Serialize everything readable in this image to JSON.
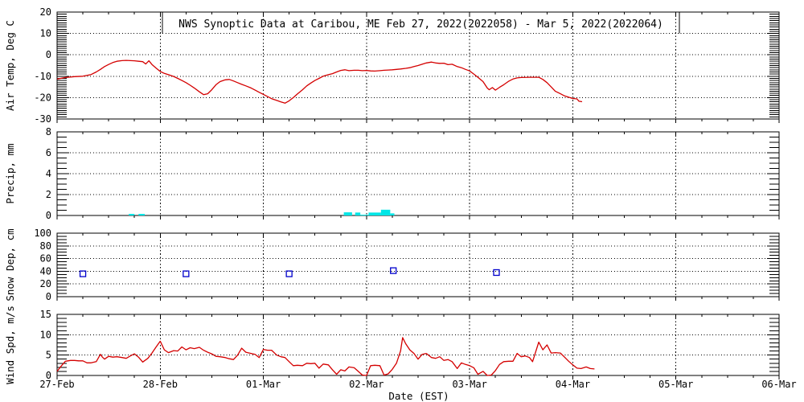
{
  "title": "NWS Synoptic Data at Caribou, ME  Feb 27, 2022(2022058) - Mar  5, 2022(2022064)",
  "xlabel": "Date (EST)",
  "colors": {
    "line_red": "#d40000",
    "precip_cyan": "#00e6e6",
    "snow_blue": "#0000cc",
    "frame_black": "#000000",
    "background": "#ffffff"
  },
  "x_axis": {
    "tick_labels": [
      "27-Feb",
      "28-Feb",
      "01-Mar",
      "02-Mar",
      "03-Mar",
      "04-Mar",
      "05-Mar",
      "06-Mar"
    ],
    "range_days": [
      0,
      7
    ],
    "minor_tick_hours": 6
  },
  "chart_data": [
    {
      "type": "line",
      "name": "air-temperature",
      "ylabel": "Air Temp, Deg C",
      "ylim": [
        -30,
        20
      ],
      "yticks": [
        -30,
        -20,
        -10,
        0,
        10,
        20
      ],
      "ygrid": [
        -20,
        -10,
        0,
        10
      ],
      "yminor": 1,
      "color_key": "line_red",
      "points": [
        [
          0.0,
          -11.3
        ],
        [
          0.08,
          -10.6
        ],
        [
          0.17,
          -10.2
        ],
        [
          0.25,
          -10.0
        ],
        [
          0.33,
          -9.2
        ],
        [
          0.38,
          -8.0
        ],
        [
          0.42,
          -6.8
        ],
        [
          0.46,
          -5.5
        ],
        [
          0.5,
          -4.5
        ],
        [
          0.54,
          -3.6
        ],
        [
          0.58,
          -3.0
        ],
        [
          0.63,
          -2.7
        ],
        [
          0.67,
          -2.6
        ],
        [
          0.71,
          -2.7
        ],
        [
          0.75,
          -2.8
        ],
        [
          0.79,
          -3.0
        ],
        [
          0.83,
          -3.2
        ],
        [
          0.86,
          -4.3
        ],
        [
          0.89,
          -2.8
        ],
        [
          0.92,
          -4.5
        ],
        [
          0.96,
          -6.2
        ],
        [
          1.0,
          -7.8
        ],
        [
          1.04,
          -8.7
        ],
        [
          1.08,
          -9.3
        ],
        [
          1.13,
          -10.1
        ],
        [
          1.17,
          -11.0
        ],
        [
          1.21,
          -12.0
        ],
        [
          1.25,
          -13.0
        ],
        [
          1.29,
          -14.2
        ],
        [
          1.33,
          -15.5
        ],
        [
          1.38,
          -17.3
        ],
        [
          1.42,
          -18.6
        ],
        [
          1.46,
          -18.2
        ],
        [
          1.5,
          -16.3
        ],
        [
          1.54,
          -14.0
        ],
        [
          1.58,
          -12.5
        ],
        [
          1.63,
          -11.7
        ],
        [
          1.67,
          -11.5
        ],
        [
          1.71,
          -12.2
        ],
        [
          1.75,
          -13.0
        ],
        [
          1.79,
          -13.8
        ],
        [
          1.83,
          -14.5
        ],
        [
          1.88,
          -15.5
        ],
        [
          1.92,
          -16.5
        ],
        [
          1.96,
          -17.5
        ],
        [
          2.0,
          -18.5
        ],
        [
          2.04,
          -19.5
        ],
        [
          2.08,
          -20.5
        ],
        [
          2.13,
          -21.3
        ],
        [
          2.17,
          -22.0
        ],
        [
          2.21,
          -22.6
        ],
        [
          2.25,
          -21.5
        ],
        [
          2.29,
          -20.0
        ],
        [
          2.33,
          -18.3
        ],
        [
          2.38,
          -16.3
        ],
        [
          2.42,
          -14.5
        ],
        [
          2.46,
          -13.2
        ],
        [
          2.5,
          -12.0
        ],
        [
          2.54,
          -11.0
        ],
        [
          2.58,
          -10.0
        ],
        [
          2.63,
          -9.3
        ],
        [
          2.67,
          -8.8
        ],
        [
          2.71,
          -8.0
        ],
        [
          2.75,
          -7.3
        ],
        [
          2.79,
          -7.0
        ],
        [
          2.83,
          -7.4
        ],
        [
          2.88,
          -7.2
        ],
        [
          2.92,
          -7.2
        ],
        [
          2.96,
          -7.4
        ],
        [
          3.0,
          -7.3
        ],
        [
          3.04,
          -7.5
        ],
        [
          3.08,
          -7.6
        ],
        [
          3.13,
          -7.4
        ],
        [
          3.17,
          -7.2
        ],
        [
          3.21,
          -7.1
        ],
        [
          3.25,
          -7.0
        ],
        [
          3.29,
          -6.8
        ],
        [
          3.33,
          -6.6
        ],
        [
          3.38,
          -6.3
        ],
        [
          3.42,
          -6.0
        ],
        [
          3.46,
          -5.5
        ],
        [
          3.5,
          -5.0
        ],
        [
          3.54,
          -4.4
        ],
        [
          3.58,
          -3.8
        ],
        [
          3.63,
          -3.4
        ],
        [
          3.67,
          -3.8
        ],
        [
          3.71,
          -4.0
        ],
        [
          3.75,
          -3.9
        ],
        [
          3.79,
          -4.6
        ],
        [
          3.83,
          -4.4
        ],
        [
          3.88,
          -5.5
        ],
        [
          3.92,
          -6.0
        ],
        [
          3.96,
          -6.8
        ],
        [
          4.0,
          -7.5
        ],
        [
          4.04,
          -9.0
        ],
        [
          4.08,
          -10.5
        ],
        [
          4.13,
          -12.5
        ],
        [
          4.17,
          -15.5
        ],
        [
          4.19,
          -16.3
        ],
        [
          4.22,
          -15.3
        ],
        [
          4.25,
          -16.5
        ],
        [
          4.29,
          -15.2
        ],
        [
          4.33,
          -14.0
        ],
        [
          4.38,
          -12.3
        ],
        [
          4.42,
          -11.3
        ],
        [
          4.46,
          -10.8
        ],
        [
          4.5,
          -10.6
        ],
        [
          4.58,
          -10.5
        ],
        [
          4.67,
          -10.5
        ],
        [
          4.71,
          -11.5
        ],
        [
          4.75,
          -13.0
        ],
        [
          4.79,
          -15.0
        ],
        [
          4.83,
          -17.0
        ],
        [
          4.88,
          -18.2
        ],
        [
          4.92,
          -19.2
        ],
        [
          4.96,
          -19.8
        ],
        [
          5.0,
          -20.4
        ],
        [
          5.04,
          -20.6
        ],
        [
          5.06,
          -21.7
        ],
        [
          5.09,
          -21.9
        ]
      ]
    },
    {
      "type": "bar",
      "name": "precipitation",
      "ylabel": "Precip, mm",
      "ylim": [
        0,
        8
      ],
      "yticks": [
        0,
        2,
        4,
        6,
        8
      ],
      "ygrid": [
        2,
        4,
        6
      ],
      "yminor": 0.5,
      "color_key": "precip_cyan",
      "bars": [
        [
          0.695,
          0.75,
          0.15
        ],
        [
          0.79,
          0.85,
          0.15
        ],
        [
          2.78,
          2.86,
          0.3
        ],
        [
          2.89,
          2.94,
          0.28
        ],
        [
          2.94,
          3.02,
          0.07
        ],
        [
          3.02,
          3.14,
          0.28
        ],
        [
          3.14,
          3.23,
          0.55
        ],
        [
          3.23,
          3.27,
          0.2
        ]
      ]
    },
    {
      "type": "scatter",
      "name": "snow-depth",
      "ylabel": "Snow Dep, cm",
      "ylim": [
        0,
        100
      ],
      "yticks": [
        0,
        20,
        40,
        60,
        80,
        100
      ],
      "ygrid": [
        20,
        40,
        60,
        80
      ],
      "yminor": 5,
      "color_key": "snow_blue",
      "marker": "open-square",
      "points": [
        [
          0.25,
          36
        ],
        [
          1.25,
          36
        ],
        [
          2.25,
          36
        ],
        [
          3.26,
          41
        ],
        [
          4.26,
          38
        ]
      ]
    },
    {
      "type": "line",
      "name": "wind-speed",
      "ylabel": "Wind Spd, m/s",
      "ylim": [
        0,
        15
      ],
      "yticks": [
        0,
        5,
        10,
        15
      ],
      "ygrid": [
        5,
        10
      ],
      "yminor": 1,
      "color_key": "line_red",
      "points": [
        [
          0.0,
          1.0
        ],
        [
          0.04,
          2.3
        ],
        [
          0.08,
          3.5
        ],
        [
          0.13,
          3.7
        ],
        [
          0.17,
          3.7
        ],
        [
          0.21,
          3.6
        ],
        [
          0.25,
          3.6
        ],
        [
          0.29,
          3.1
        ],
        [
          0.33,
          3.1
        ],
        [
          0.38,
          3.4
        ],
        [
          0.42,
          5.2
        ],
        [
          0.44,
          4.5
        ],
        [
          0.46,
          4.0
        ],
        [
          0.5,
          4.7
        ],
        [
          0.54,
          4.5
        ],
        [
          0.58,
          4.6
        ],
        [
          0.63,
          4.4
        ],
        [
          0.67,
          4.2
        ],
        [
          0.71,
          4.8
        ],
        [
          0.75,
          5.3
        ],
        [
          0.79,
          4.5
        ],
        [
          0.83,
          3.3
        ],
        [
          0.88,
          4.2
        ],
        [
          0.92,
          5.5
        ],
        [
          0.96,
          7.0
        ],
        [
          1.0,
          8.4
        ],
        [
          1.04,
          6.3
        ],
        [
          1.08,
          5.6
        ],
        [
          1.13,
          6.1
        ],
        [
          1.17,
          6.0
        ],
        [
          1.21,
          7.0
        ],
        [
          1.25,
          6.3
        ],
        [
          1.29,
          6.8
        ],
        [
          1.33,
          6.6
        ],
        [
          1.38,
          6.9
        ],
        [
          1.42,
          6.2
        ],
        [
          1.46,
          5.7
        ],
        [
          1.5,
          5.3
        ],
        [
          1.54,
          4.7
        ],
        [
          1.58,
          4.6
        ],
        [
          1.63,
          4.4
        ],
        [
          1.67,
          4.1
        ],
        [
          1.71,
          3.9
        ],
        [
          1.75,
          5.0
        ],
        [
          1.79,
          6.7
        ],
        [
          1.83,
          5.7
        ],
        [
          1.88,
          5.4
        ],
        [
          1.92,
          5.2
        ],
        [
          1.96,
          4.4
        ],
        [
          2.0,
          6.4
        ],
        [
          2.04,
          6.2
        ],
        [
          2.08,
          6.2
        ],
        [
          2.13,
          5.0
        ],
        [
          2.17,
          4.6
        ],
        [
          2.21,
          4.4
        ],
        [
          2.25,
          3.4
        ],
        [
          2.29,
          2.4
        ],
        [
          2.33,
          2.5
        ],
        [
          2.38,
          2.4
        ],
        [
          2.42,
          3.0
        ],
        [
          2.46,
          2.9
        ],
        [
          2.5,
          3.0
        ],
        [
          2.54,
          1.8
        ],
        [
          2.58,
          2.8
        ],
        [
          2.63,
          2.6
        ],
        [
          2.67,
          1.4
        ],
        [
          2.71,
          0.3
        ],
        [
          2.75,
          1.4
        ],
        [
          2.79,
          1.1
        ],
        [
          2.83,
          2.1
        ],
        [
          2.88,
          1.9
        ],
        [
          2.92,
          1.0
        ],
        [
          2.96,
          0.1
        ],
        [
          3.0,
          0.0
        ],
        [
          3.04,
          2.4
        ],
        [
          3.08,
          2.5
        ],
        [
          3.13,
          2.4
        ],
        [
          3.17,
          0.1
        ],
        [
          3.21,
          0.4
        ],
        [
          3.25,
          1.5
        ],
        [
          3.29,
          3.0
        ],
        [
          3.33,
          6.0
        ],
        [
          3.35,
          9.3
        ],
        [
          3.38,
          7.8
        ],
        [
          3.42,
          6.3
        ],
        [
          3.46,
          5.4
        ],
        [
          3.5,
          4.0
        ],
        [
          3.54,
          5.2
        ],
        [
          3.58,
          5.4
        ],
        [
          3.63,
          4.4
        ],
        [
          3.67,
          4.2
        ],
        [
          3.71,
          4.6
        ],
        [
          3.75,
          3.7
        ],
        [
          3.79,
          3.9
        ],
        [
          3.83,
          3.4
        ],
        [
          3.88,
          1.7
        ],
        [
          3.92,
          3.1
        ],
        [
          3.96,
          2.7
        ],
        [
          4.0,
          2.4
        ],
        [
          4.04,
          1.9
        ],
        [
          4.08,
          0.3
        ],
        [
          4.13,
          1.0
        ],
        [
          4.17,
          0.0
        ],
        [
          4.21,
          0.1
        ],
        [
          4.25,
          1.2
        ],
        [
          4.29,
          2.7
        ],
        [
          4.33,
          3.4
        ],
        [
          4.38,
          3.5
        ],
        [
          4.42,
          3.5
        ],
        [
          4.46,
          5.4
        ],
        [
          4.5,
          4.6
        ],
        [
          4.54,
          4.8
        ],
        [
          4.58,
          4.4
        ],
        [
          4.61,
          3.4
        ],
        [
          4.67,
          8.2
        ],
        [
          4.71,
          6.3
        ],
        [
          4.75,
          7.5
        ],
        [
          4.79,
          5.5
        ],
        [
          4.83,
          5.6
        ],
        [
          4.88,
          5.5
        ],
        [
          4.92,
          4.5
        ],
        [
          4.96,
          3.5
        ],
        [
          5.0,
          2.6
        ],
        [
          5.04,
          1.8
        ],
        [
          5.08,
          1.7
        ],
        [
          5.13,
          2.1
        ],
        [
          5.17,
          1.7
        ],
        [
          5.21,
          1.6
        ]
      ]
    }
  ]
}
